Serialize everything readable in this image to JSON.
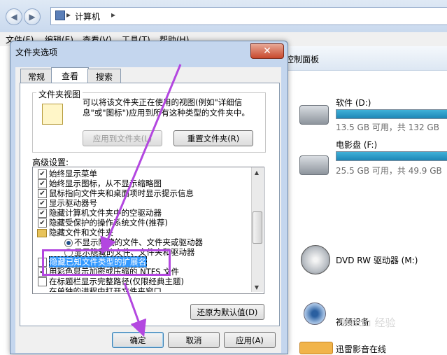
{
  "explorer": {
    "breadcrumb": "计算机",
    "menu": [
      "文件(F)",
      "编辑(E)",
      "查看(V)",
      "工具(T)",
      "帮助(H)"
    ],
    "command_text": "控制面板"
  },
  "drives": [
    {
      "name": "软件 (D:)",
      "info": "13.5 GB 可用，共 132 GB",
      "fill": 0.9
    },
    {
      "name": "电影盘 (F:)",
      "info": "25.5 GB 可用，共 49.9 GB",
      "fill": 0.49
    },
    {
      "name": "DVD RW 驱动器 (M:)"
    },
    {
      "name": "视频设备"
    },
    {
      "name": "迅雷影音在线"
    }
  ],
  "dialog": {
    "title": "文件夹选项",
    "close_symbol": "✕",
    "tabs": [
      "常规",
      "查看",
      "搜索"
    ],
    "group_title": "文件夹视图",
    "group_desc": "可以将该文件夹正在使用的视图(例如\"详细信息\"或\"图标\")应用到所有这种类型的文件夹中。",
    "apply_folders": "应用到文件夹(L)",
    "reset_folders": "重置文件夹(R)",
    "advanced_label": "高级设置:",
    "settings": [
      {
        "type": "checkbox",
        "checked": true,
        "label": "始终显示菜单"
      },
      {
        "type": "checkbox",
        "checked": true,
        "label": "始终显示图标，从不显示缩略图"
      },
      {
        "type": "checkbox",
        "checked": true,
        "label": "鼠标指向文件夹和桌面项时显示提示信息"
      },
      {
        "type": "checkbox",
        "checked": true,
        "label": "显示驱动器号"
      },
      {
        "type": "checkbox",
        "checked": true,
        "label": "隐藏计算机文件夹中的空驱动器"
      },
      {
        "type": "checkbox",
        "checked": true,
        "label": "隐藏受保护的操作系统文件(推荐)"
      },
      {
        "type": "folder",
        "label": "隐藏文件和文件夹"
      },
      {
        "type": "radio",
        "checked": true,
        "label": "不显示隐藏的文件、文件夹或驱动器"
      },
      {
        "type": "radio",
        "checked": false,
        "label": "显示隐藏的文件、文件夹和驱动器"
      },
      {
        "type": "checkbox",
        "checked": false,
        "label": "隐藏已知文件类型的扩展名",
        "selected": true
      },
      {
        "type": "checkbox",
        "checked": true,
        "label": "用彩色显示加密或压缩的 NTFS 文件"
      },
      {
        "type": "checkbox",
        "checked": false,
        "label": "在标题栏显示完整路径(仅限经典主题)"
      },
      {
        "type": "checkbox",
        "checked": false,
        "label": "在单独的进程中打开文件夹窗口"
      }
    ],
    "restore_defaults": "还原为默认值(D)",
    "ok": "确定",
    "cancel": "取消",
    "apply": "应用(A)"
  },
  "watermark": "Baidu 经验"
}
